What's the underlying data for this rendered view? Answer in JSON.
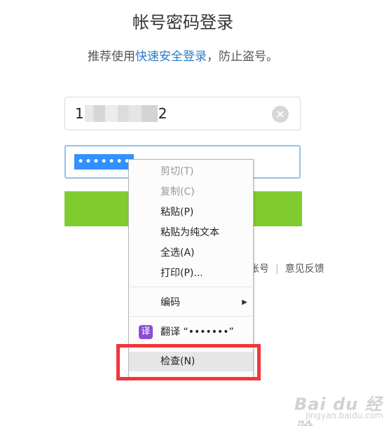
{
  "title": "帐号密码登录",
  "subtitle": {
    "prefix": "推荐使用",
    "link": "快速安全登录",
    "suffix": "，防止盗号。"
  },
  "username": {
    "first_char": "1",
    "last_char": "2"
  },
  "password": {
    "selected_value": "•••••••"
  },
  "links": {
    "register_partial": "帐号",
    "feedback": "意见反馈",
    "separator": "|"
  },
  "context_menu": {
    "items": [
      {
        "label": "剪切(T)",
        "disabled": true
      },
      {
        "label": "复制(C)",
        "disabled": true
      },
      {
        "label": "粘贴(P)",
        "disabled": false
      },
      {
        "label": "粘贴为纯文本",
        "disabled": false
      },
      {
        "label": "全选(A)",
        "disabled": false
      },
      {
        "label": "打印(P)...",
        "disabled": false
      },
      {
        "label": "编码",
        "disabled": false,
        "submenu": true
      },
      {
        "label": "翻译 “•••••••”",
        "disabled": false,
        "icon": "translate-icon",
        "icon_text": "译"
      },
      {
        "label": "检查(N)",
        "disabled": false,
        "highlighted": true
      }
    ]
  },
  "watermark": {
    "main": "Bai du 经验",
    "sub": "jingyan.baidu.com"
  },
  "colors": {
    "accent_green": "#80cc2f",
    "link_blue": "#2a7cc7",
    "selection_blue": "#3390ff",
    "highlight_red": "#f0373a",
    "translate_purple": "#8a4dd6"
  }
}
